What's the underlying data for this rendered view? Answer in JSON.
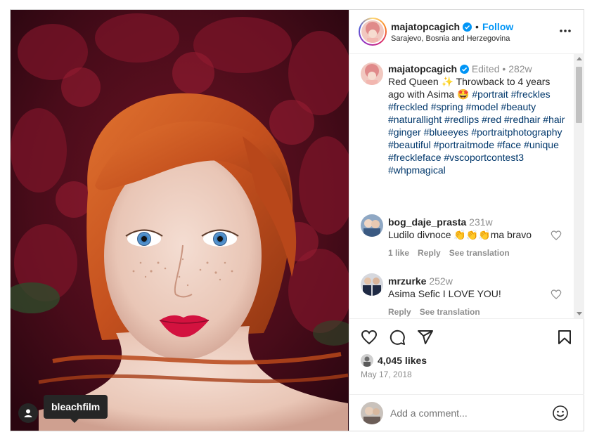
{
  "photo": {
    "tagged_user": "bleachfilm"
  },
  "header": {
    "username": "majatopcagich",
    "separator": "•",
    "follow_label": "Follow",
    "location": "Sarajevo, Bosnia and Herzegovina"
  },
  "caption": {
    "username": "majatopcagich",
    "edited": "Edited",
    "separator": "•",
    "age": "282w",
    "text_start": "Red Queen ✨ Throwback to 4 years ago with Asima 🤩",
    "hashtags": [
      "#portrait",
      "#freckles",
      "#freckled",
      "#spring",
      "#model",
      "#beauty",
      "#naturallight",
      "#redlips",
      "#red",
      "#redhair",
      "#hair",
      "#ginger",
      "#blueeyes",
      "#portraitphotography",
      "#beautiful",
      "#portraitmode",
      "#face",
      "#unique",
      "#freckleface",
      "#vscoportcontest3",
      "#whpmagical"
    ]
  },
  "comments": [
    {
      "username": "bog_daje_prasta",
      "age": "231w",
      "text": "Ludilo divnoce 👏👏👏ma bravo",
      "likes_label": "1 like",
      "reply_label": "Reply",
      "translate_label": "See translation"
    },
    {
      "username": "mrzurke",
      "age": "252w",
      "text": "Asima Sefic I LOVE YOU!",
      "reply_label": "Reply",
      "translate_label": "See translation"
    }
  ],
  "stats": {
    "likes": "4,045 likes",
    "date": "May 17, 2018"
  },
  "comment_box": {
    "placeholder": "Add a comment..."
  },
  "icons": [
    "heart-icon",
    "comment-icon",
    "share-icon",
    "bookmark-icon",
    "more-icon",
    "verified-icon",
    "emoji-icon",
    "user-tag-icon"
  ],
  "colors": {
    "accent": "#0095f6",
    "hashtag": "#00376b",
    "muted": "#8e8e8e",
    "text": "#262626"
  }
}
